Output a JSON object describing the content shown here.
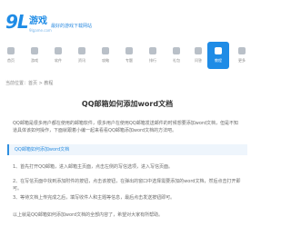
{
  "header": {
    "logo_mark": "9L",
    "logo_cn": "游戏",
    "logo_sub": "9lgame.com",
    "slogan": "最好的游戏下载网站"
  },
  "nav": [
    {
      "label": "首页",
      "icon": "home-icon"
    },
    {
      "label": "游戏",
      "icon": "game-icon"
    },
    {
      "label": "软件",
      "icon": "app-icon"
    },
    {
      "label": "资讯",
      "icon": "news-icon"
    },
    {
      "label": "攻略",
      "icon": "guide-icon"
    },
    {
      "label": "专题",
      "icon": "topic-icon"
    },
    {
      "label": "排行",
      "icon": "rank-icon"
    },
    {
      "label": "礼包",
      "icon": "gift-icon"
    },
    {
      "label": "问答",
      "icon": "qa-icon"
    },
    {
      "label": "教程",
      "icon": "tutorial-icon",
      "active": true
    },
    {
      "label": "更多",
      "icon": "more-icon"
    }
  ],
  "breadcrumb": "当前位置：首页 > 教程",
  "article": {
    "title": "QQ邮箱如何添加word文档",
    "p1": "QQ邮箱是很多用户都在使用的邮箱软件，很多用户在使用QQ邮箱发送邮件的时候想要添加word文档，但是不知道具体该如何操作，下面就跟着小编一起来看看QQ邮箱添加word文档的方法吧。",
    "subhead": "QQ邮箱如何添加word文档",
    "p2": "1、首先打开QQ邮箱，进入邮箱主页面，点击左侧的写信选项，进入写信页面。",
    "p3": "2、在写信页面中找到添加附件的按钮，点击该按钮，在弹出的窗口中选择需要添加的word文档，然后点击打开即可。",
    "p4": "3、等待文档上传完成之后，填写收件人和主题等信息，最后点击发送按钮即可。",
    "p5": "以上就是QQ邮箱如何添加word文档的全部内容了，希望对大家有所帮助。"
  }
}
